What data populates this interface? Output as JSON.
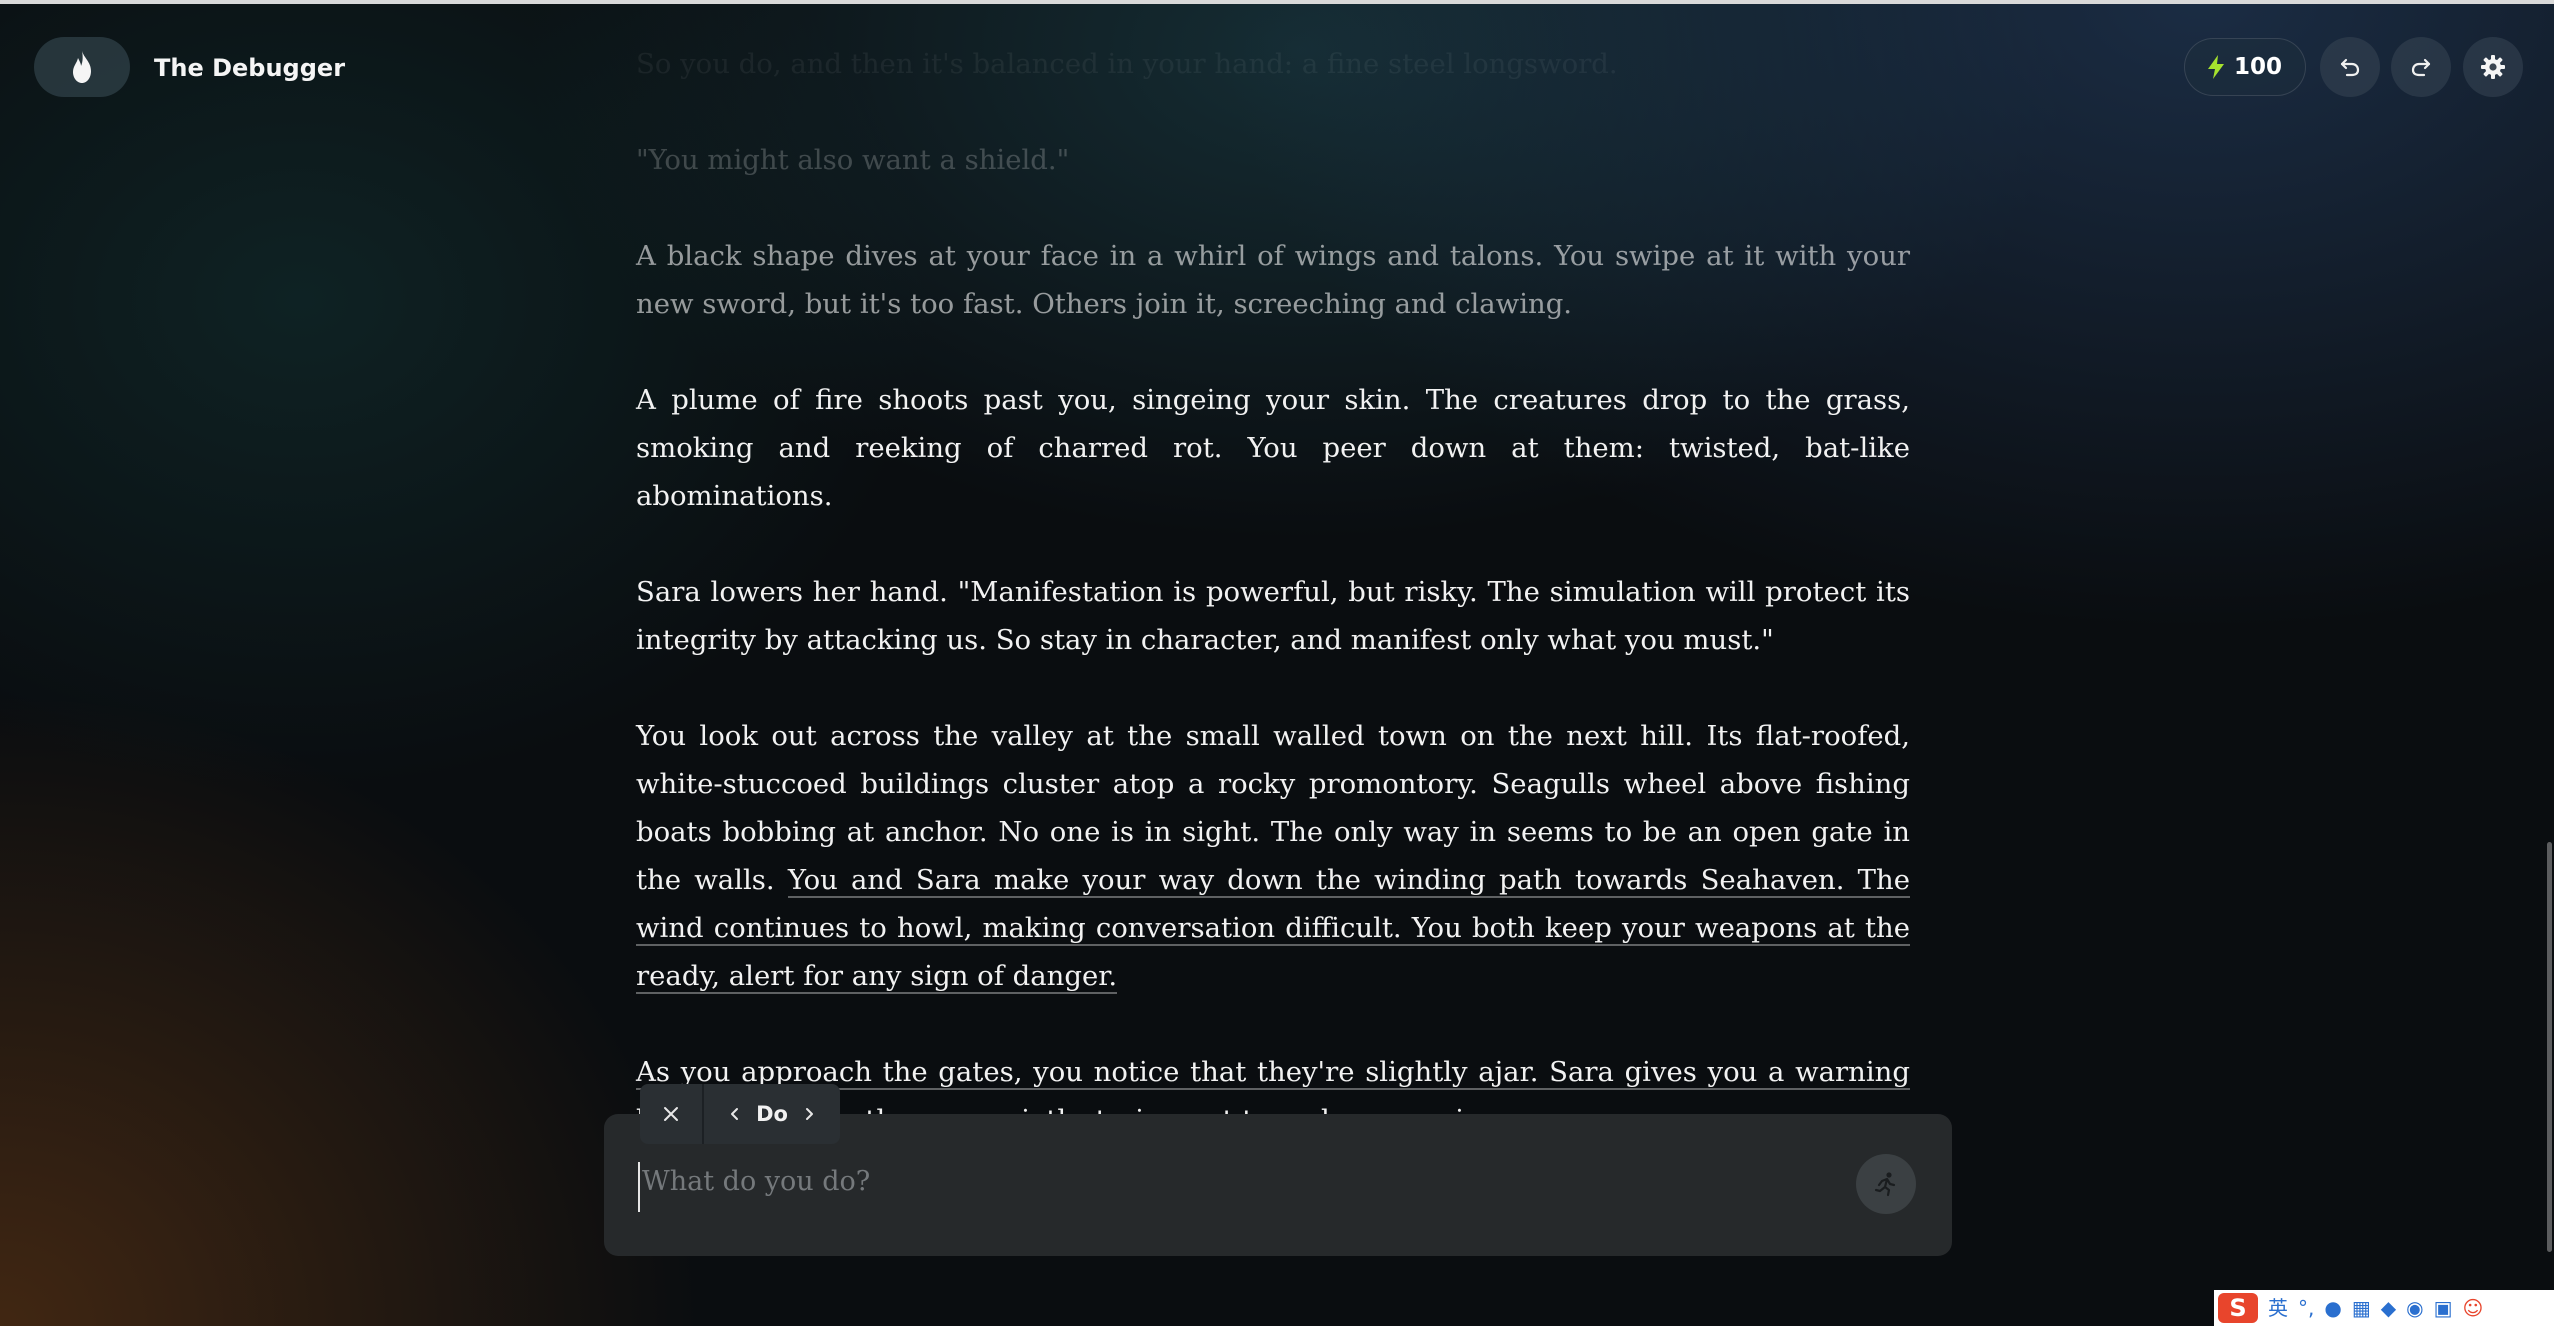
{
  "header": {
    "app_title": "The Debugger",
    "energy_count": "100"
  },
  "story": {
    "paragraphs": [
      {
        "text": "So you do, and then it's balanced in your hand: a fine steel longsword.",
        "opacity": 0.06
      },
      {
        "text": "\"You might also want a shield.\"",
        "opacity": 0.22
      },
      {
        "text": "A black shape dives at your face in a whirl of wings and talons. You swipe at it with your new sword, but it's too fast. Others join it, screeching and clawing.",
        "opacity": 0.6
      },
      {
        "text": "A plume of fire shoots past you, singeing your skin. The creatures drop to the grass, smoking and reeking of charred rot. You peer down at them: twisted, bat-like abominations.",
        "opacity": 1
      },
      {
        "text": "Sara lowers her hand. \"Manifestation is powerful, but risky. The simulation will protect its integrity by attacking us. So stay in character, and manifest only what you must.\"",
        "opacity": 1
      },
      {
        "text": "You look out across the valley at the small walled town on the next hill. Its flat-roofed, white-stuccoed buildings cluster atop a rocky promontory. Seagulls wheel above fishing boats bobbing at anchor. No one is in sight. The only way in seems to be an open gate in the walls.",
        "highlight": "You and Sara make your way down the winding path towards Seahaven. The wind continues to howl, making conversation difficult. You both keep your weapons at the ready, alert for any sign of danger.",
        "opacity": 1
      },
      {
        "highlight": "As you approach the gates, you notice that they're slightly ajar. Sara gives you a warning look, and you both move quietly, trying not to make any noise.",
        "opacity": 1
      }
    ]
  },
  "action_mode": {
    "label": "Do"
  },
  "input": {
    "placeholder": "What do you do?",
    "value": ""
  },
  "tray": {
    "ime_label": "英",
    "logo": "S"
  },
  "colors": {
    "energy_icon": "#a6e22e",
    "background": "#0a0d10",
    "input_bg": "#26292b"
  }
}
